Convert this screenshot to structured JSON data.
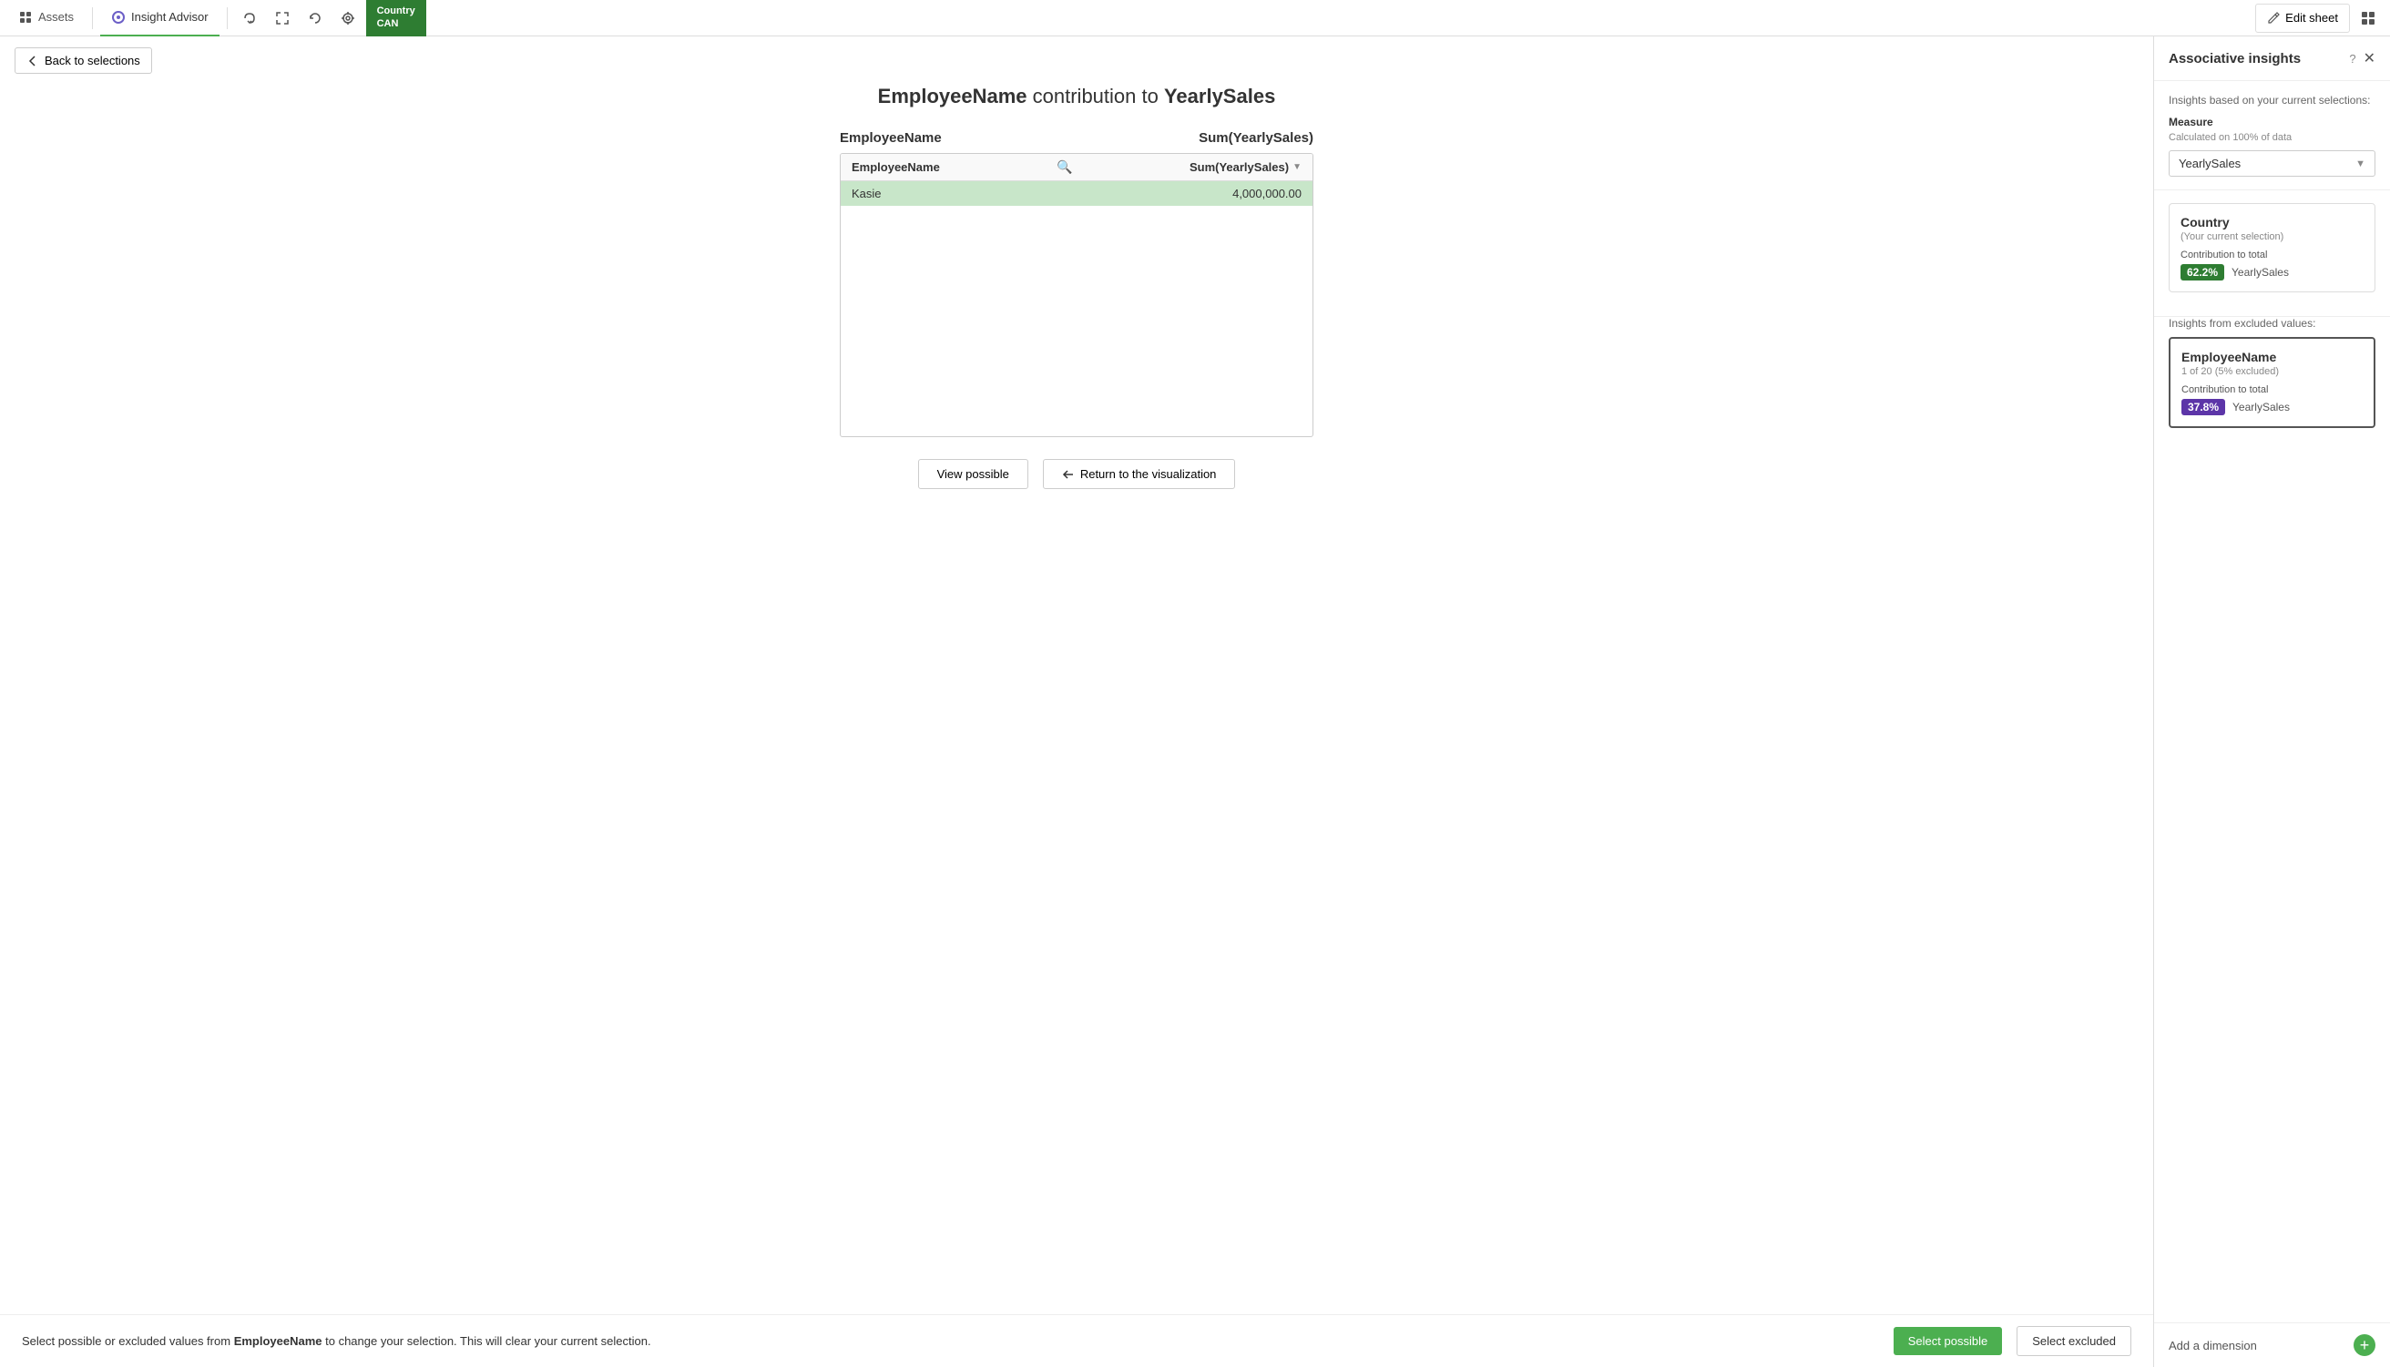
{
  "topNav": {
    "assets_label": "Assets",
    "insight_advisor_label": "Insight Advisor",
    "edit_sheet_label": "Edit sheet",
    "country_tab": {
      "label": "Country",
      "value": "CAN"
    }
  },
  "backButton": {
    "label": "Back to selections"
  },
  "chartTitle": {
    "part1": "EmployeeName",
    "middle": " contribution to ",
    "part2": "YearlySales"
  },
  "tableColumns": {
    "col1": "EmployeeName",
    "col2": "Sum(YearlySales)"
  },
  "tableRows": [
    {
      "name": "Kasie",
      "value": "4,000,000.00",
      "selected": true
    }
  ],
  "viewPossibleBtn": "View possible",
  "returnVisualizationBtn": "Return to the visualization",
  "notificationBar": {
    "text": "Select possible or excluded values from ",
    "fieldName": "EmployeeName",
    "text2": " to change your selection. This will clear your current selection.",
    "selectPossibleBtn": "Select possible",
    "selectExcludedBtn": "Select excluded"
  },
  "sidebar": {
    "title": "Associative insights",
    "description": "Insights based on your current selections:",
    "measureLabel": "Measure",
    "measureSublabel": "Calculated on 100% of data",
    "measureValue": "YearlySales",
    "currentSelectionCard": {
      "title": "Country",
      "subtitle": "(Your current selection)",
      "contributionLabel": "Contribution to total",
      "badgeValue": "62.2%",
      "badgeLabel": "YearlySales"
    },
    "excludedHeader": "Insights from excluded values:",
    "excludedCard": {
      "title": "EmployeeName",
      "subtitle": "1 of 20 (5% excluded)",
      "contributionLabel": "Contribution to total",
      "badgeValue": "37.8%",
      "badgeLabel": "YearlySales"
    },
    "addDimensionLabel": "Add a dimension"
  }
}
